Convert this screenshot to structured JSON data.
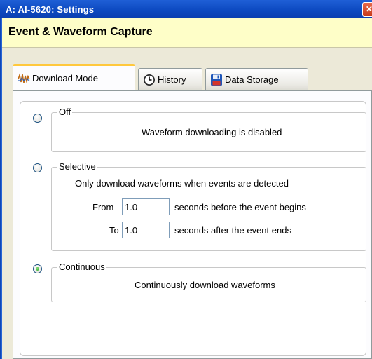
{
  "window": {
    "title": "A: AI-5620: Settings",
    "close_glyph": "✕"
  },
  "header": {
    "title": "Event & Waveform Capture"
  },
  "tabs": [
    {
      "label": "Download Mode",
      "icon": "waveform-icon",
      "active": true
    },
    {
      "label": "History",
      "icon": "clock-icon",
      "active": false
    },
    {
      "label": "Data Storage",
      "icon": "floppy-disk-icon",
      "active": false
    }
  ],
  "modes": {
    "off": {
      "label": "Off",
      "description": "Waveform downloading is disabled",
      "selected": false
    },
    "selective": {
      "label": "Selective",
      "description": "Only download waveforms when events are detected",
      "from_label": "From",
      "from_value": "1.0",
      "from_suffix": "seconds before the event begins",
      "to_label": "To",
      "to_value": "1.0",
      "to_suffix": "seconds after the event ends",
      "selected": false
    },
    "continuous": {
      "label": "Continuous",
      "description": "Continuously download waveforms",
      "selected": true
    }
  }
}
